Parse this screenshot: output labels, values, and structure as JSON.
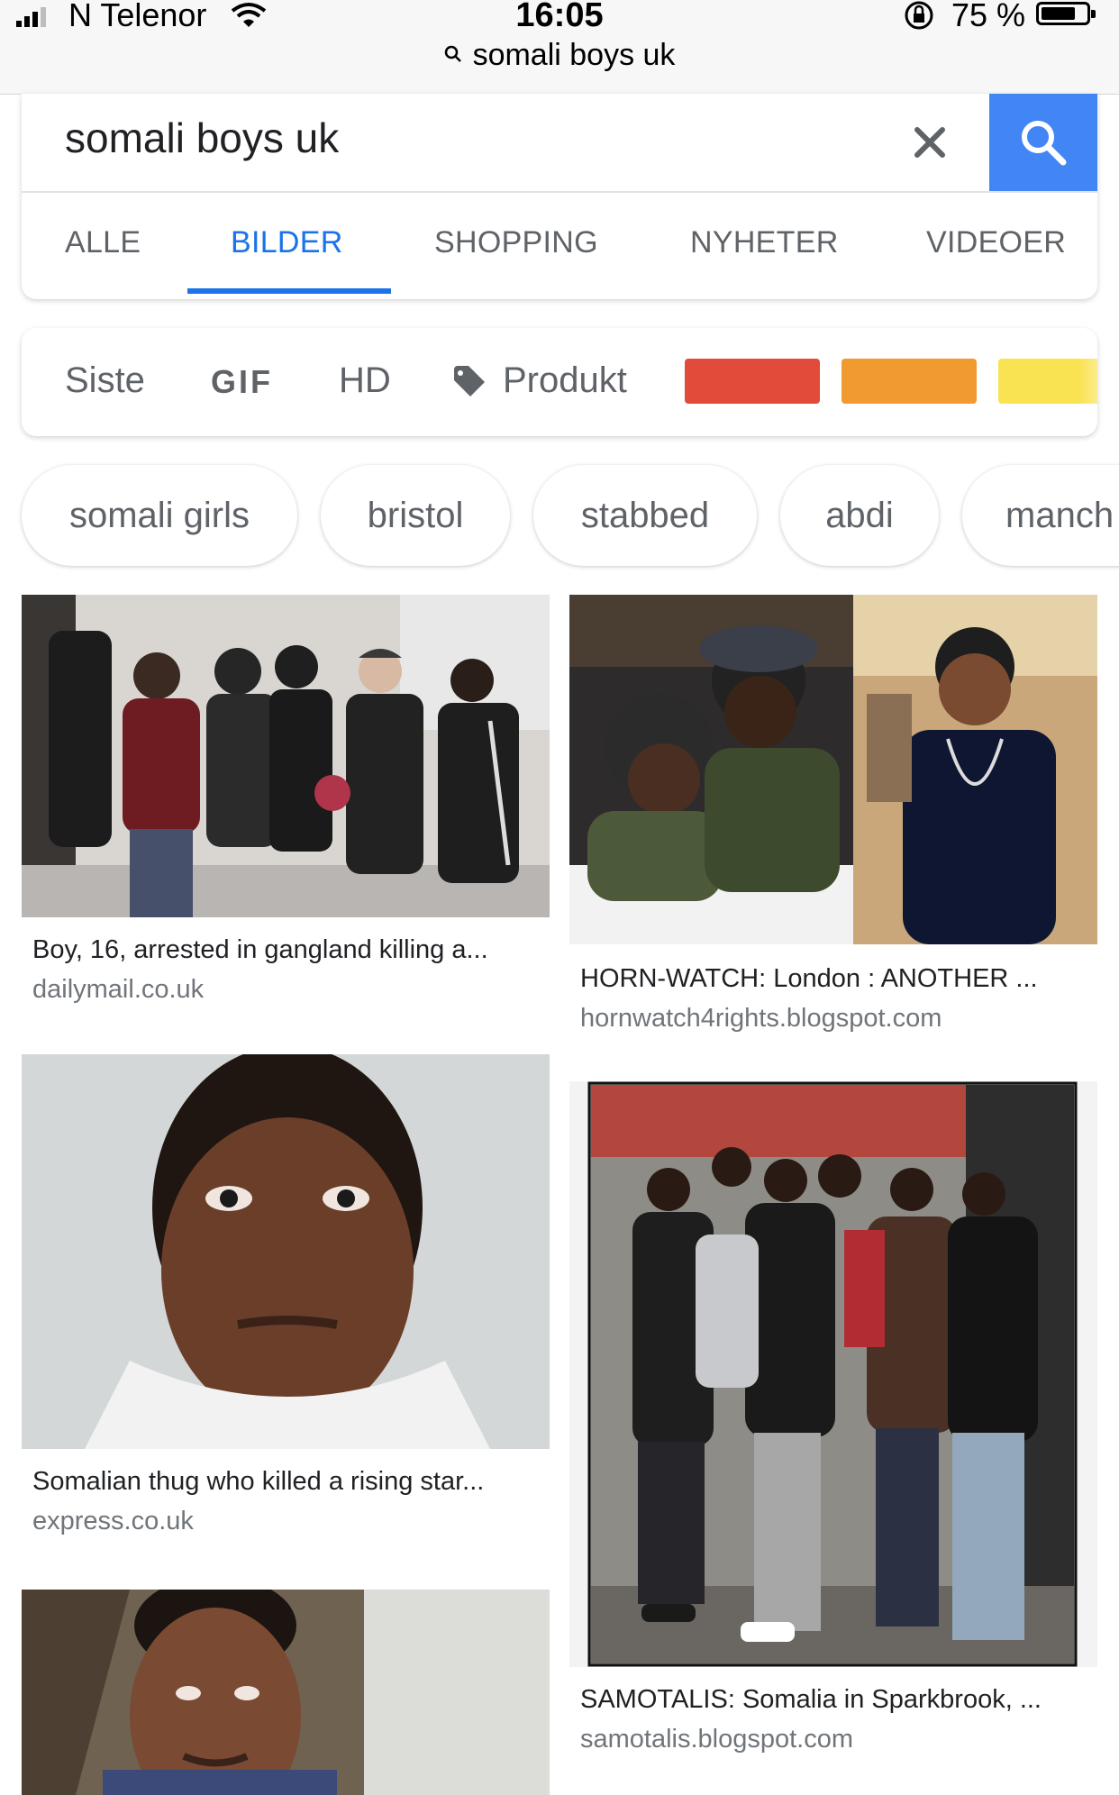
{
  "status_bar": {
    "carrier": "N Telenor",
    "time": "16:05",
    "battery": "75 %",
    "url": "somali boys uk"
  },
  "search": {
    "query": "somali boys uk"
  },
  "tabs": [
    "ALLE",
    "BILDER",
    "SHOPPING",
    "NYHETER",
    "VIDEOER"
  ],
  "active_tab": "BILDER",
  "filters": {
    "items": [
      "Siste",
      "GIF",
      "HD",
      "Produkt"
    ],
    "color_swatches": [
      "#e04b3a",
      "#f09a30",
      "#f9e352"
    ]
  },
  "related_chips": [
    "somali girls",
    "bristol",
    "stabbed",
    "abdi",
    "manch"
  ],
  "results": [
    {
      "title": "Boy, 16, arrested in gangland killing a...",
      "domain": "dailymail.co.uk"
    },
    {
      "title": "HORN-WATCH: London : ANOTHER ...",
      "domain": "hornwatch4rights.blogspot.com"
    },
    {
      "title": "Somalian thug who killed a rising star...",
      "domain": "express.co.uk"
    },
    {
      "title": "SAMOTALIS: Somalia in Sparkbrook, ...",
      "domain": "samotalis.blogspot.com"
    }
  ],
  "colors": {
    "accent_blue": "#1a73e8",
    "search_button": "#4285f4"
  }
}
